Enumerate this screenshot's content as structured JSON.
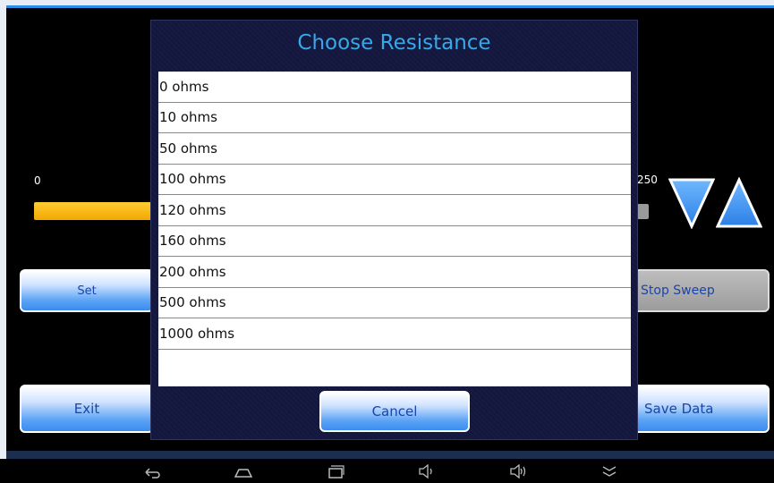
{
  "slider": {
    "min_label": "0",
    "max_label": "250"
  },
  "buttons": {
    "set": "Set",
    "exit": "Exit",
    "stop_sweep": "Stop Sweep",
    "save_data": "Save Data"
  },
  "dialog": {
    "title": "Choose Resistance",
    "items": [
      "0 ohms",
      "10 ohms",
      "50 ohms",
      "100 ohms",
      "120 ohms",
      "160 ohms",
      "200 ohms",
      "500 ohms",
      "1000 ohms"
    ],
    "cancel": "Cancel"
  },
  "icons": {
    "down_arrow": "triangle-down",
    "up_arrow": "triangle-up",
    "nav": [
      "back",
      "home",
      "recent-apps",
      "volume-down",
      "volume-up",
      "expand"
    ]
  },
  "colors": {
    "dialog_title": "#36a9e8",
    "accent_blue": "#3b8cf0",
    "slider_fill": "#f2a800",
    "top_bar": "#2b8fe6"
  }
}
